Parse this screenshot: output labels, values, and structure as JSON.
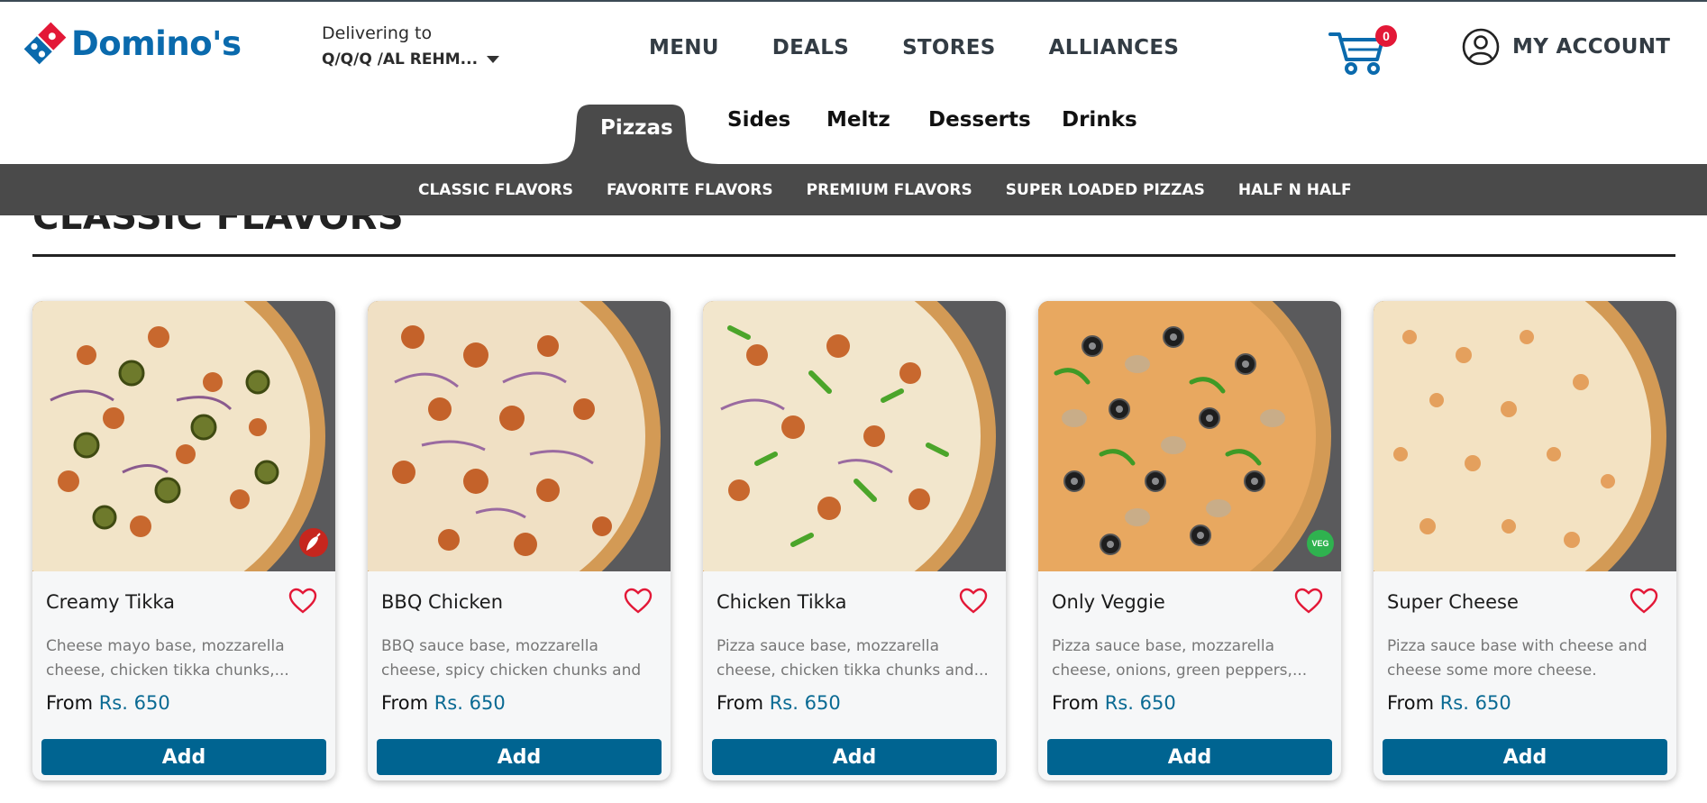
{
  "brand": {
    "name": "Domino's",
    "primary_color": "#0a6aad",
    "accent_color": "#e31837"
  },
  "delivery": {
    "label": "Delivering to",
    "address": "Q/Q/Q /AL REHM..."
  },
  "top_nav": [
    "MENU",
    "DEALS",
    "STORES",
    "ALLIANCES"
  ],
  "cart": {
    "count": "0",
    "icon": "cart-icon"
  },
  "account": {
    "label": "MY ACCOUNT",
    "icon": "user-circle-icon"
  },
  "categories": [
    {
      "label": "Pizzas",
      "active": true
    },
    {
      "label": "Sides",
      "active": false
    },
    {
      "label": "Meltz",
      "active": false
    },
    {
      "label": "Desserts",
      "active": false
    },
    {
      "label": "Drinks",
      "active": false
    }
  ],
  "subcategories": [
    "CLASSIC FLAVORS",
    "FAVORITE FLAVORS",
    "PREMIUM FLAVORS",
    "SUPER LOADED PIZZAS",
    "HALF N HALF"
  ],
  "section": {
    "title": "CLASSIC FLAVORS"
  },
  "products": [
    {
      "name": "Creamy Tikka",
      "description": "Cheese mayo base, mozzarella cheese, chicken tikka chunks,...",
      "price_prefix": "From",
      "price": "Rs. 650",
      "button": "Add",
      "badge": "spicy"
    },
    {
      "name": "BBQ Chicken",
      "description": "BBQ sauce base, mozzarella cheese, spicy chicken chunks and onions.",
      "price_prefix": "From",
      "price": "Rs. 650",
      "button": "Add",
      "badge": ""
    },
    {
      "name": "Chicken Tikka",
      "description": "Pizza sauce base, mozzarella cheese, chicken tikka chunks and...",
      "price_prefix": "From",
      "price": "Rs. 650",
      "button": "Add",
      "badge": ""
    },
    {
      "name": "Only Veggie",
      "description": "Pizza sauce base, mozzarella cheese, onions, green peppers,...",
      "price_prefix": "From",
      "price": "Rs. 650",
      "button": "Add",
      "badge": "VEG"
    },
    {
      "name": "Super Cheese",
      "description": "Pizza sauce base with cheese and cheese some more cheese.",
      "price_prefix": "From",
      "price": "Rs. 650",
      "button": "Add",
      "badge": ""
    }
  ]
}
